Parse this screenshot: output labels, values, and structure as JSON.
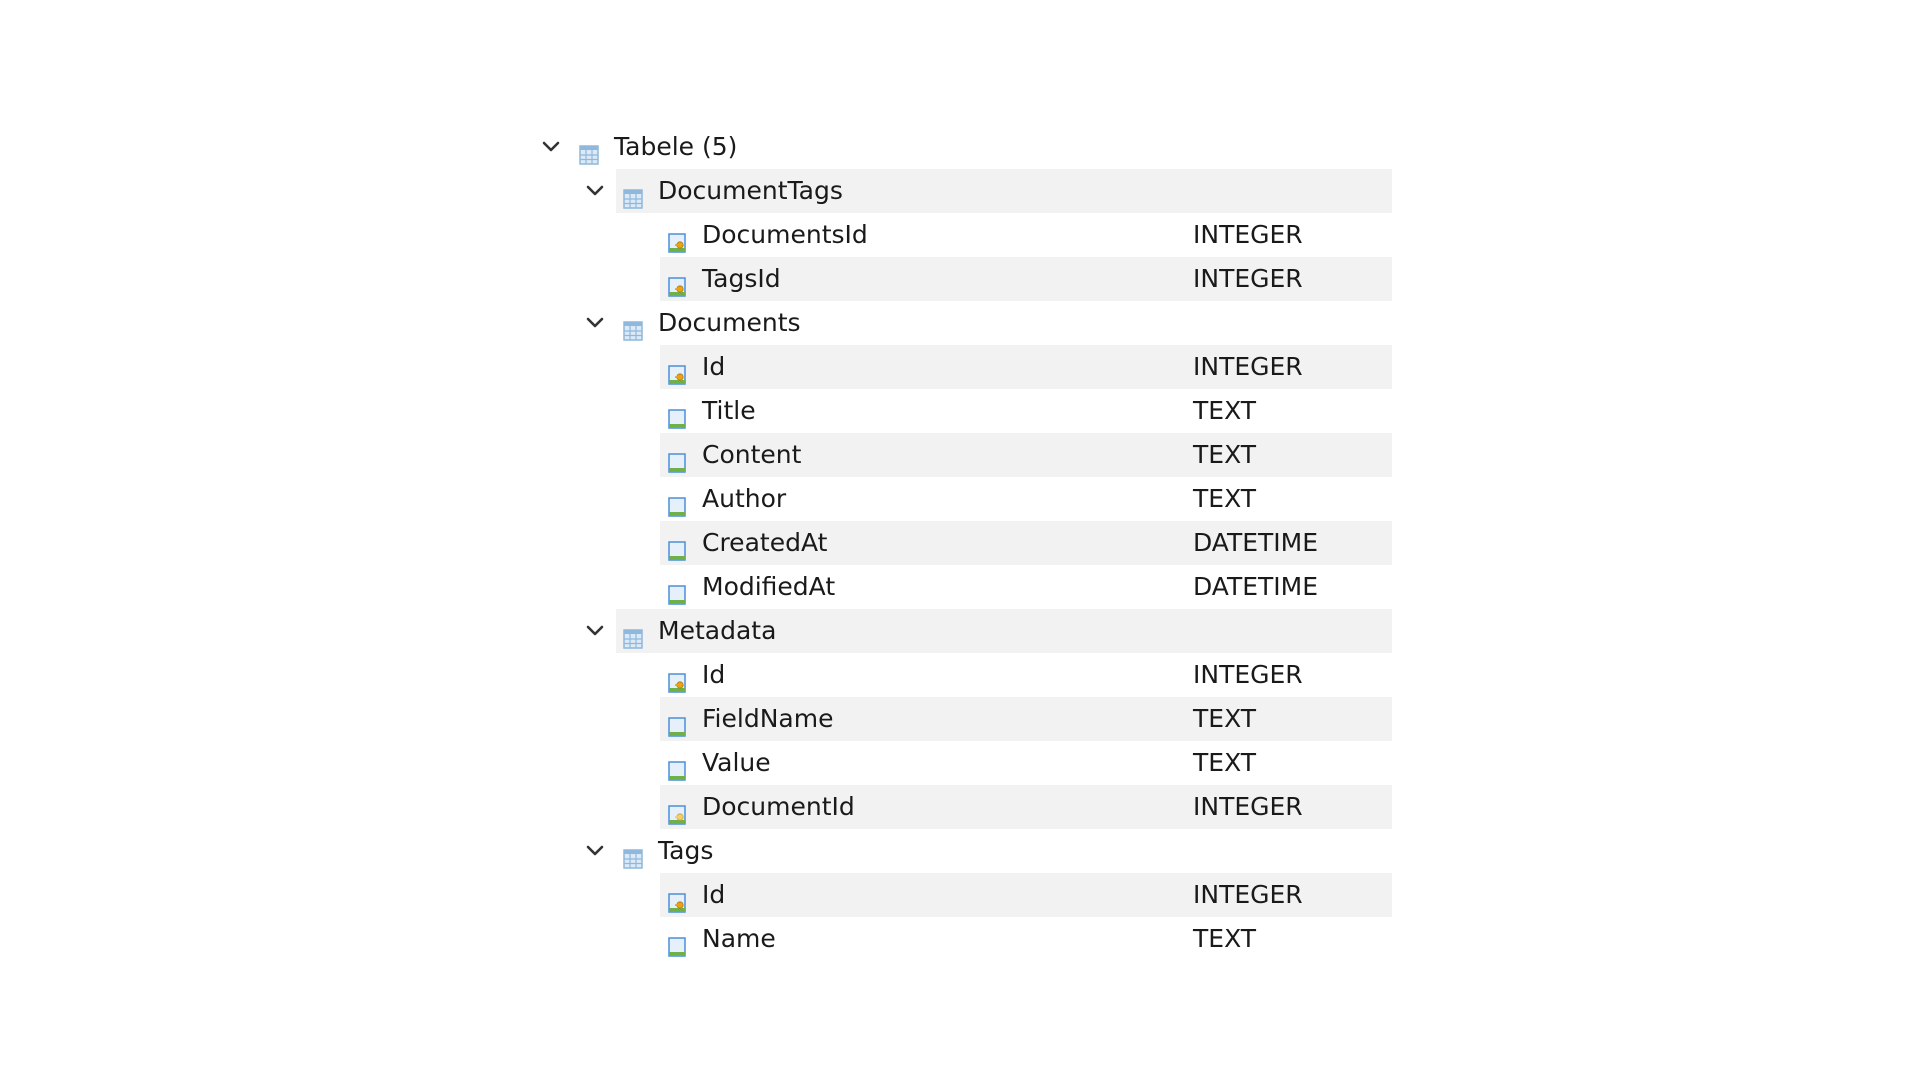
{
  "tree": {
    "root_label": "Tabele (5)",
    "tables": [
      {
        "name": "DocumentTags",
        "columns": [
          {
            "name": "DocumentsId",
            "type": "INTEGER",
            "icon": "key-column-icon"
          },
          {
            "name": "TagsId",
            "type": "INTEGER",
            "icon": "key-column-icon"
          }
        ]
      },
      {
        "name": "Documents",
        "columns": [
          {
            "name": "Id",
            "type": "INTEGER",
            "icon": "key-column-icon"
          },
          {
            "name": "Title",
            "type": "TEXT",
            "icon": "column-icon"
          },
          {
            "name": "Content",
            "type": "TEXT",
            "icon": "column-icon"
          },
          {
            "name": "Author",
            "type": "TEXT",
            "icon": "column-icon"
          },
          {
            "name": "CreatedAt",
            "type": "DATETIME",
            "icon": "column-icon"
          },
          {
            "name": "ModifiedAt",
            "type": "DATETIME",
            "icon": "column-icon"
          }
        ]
      },
      {
        "name": "Metadata",
        "columns": [
          {
            "name": "Id",
            "type": "INTEGER",
            "icon": "key-column-icon"
          },
          {
            "name": "FieldName",
            "type": "TEXT",
            "icon": "column-icon"
          },
          {
            "name": "Value",
            "type": "TEXT",
            "icon": "column-icon"
          },
          {
            "name": "DocumentId",
            "type": "INTEGER",
            "icon": "foreign-key-column-icon"
          }
        ]
      },
      {
        "name": "Tags",
        "columns": [
          {
            "name": "Id",
            "type": "INTEGER",
            "icon": "key-column-icon"
          },
          {
            "name": "Name",
            "type": "TEXT",
            "icon": "column-icon"
          }
        ]
      }
    ]
  },
  "colors": {
    "row_stripe": "#f2f2f2",
    "table_icon": "#8fb8dc",
    "column_icon": "#4a90d9",
    "key_accent": "#e8a317"
  },
  "icons": {
    "expanded": "chevron-down-icon",
    "root": "tables-folder-icon",
    "table": "table-icon"
  }
}
